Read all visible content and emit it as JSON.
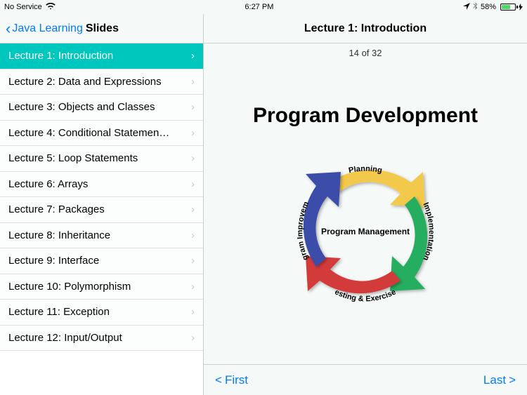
{
  "status": {
    "service": "No Service",
    "time": "6:27 PM",
    "battery_percent": "58%"
  },
  "sidebar": {
    "back_label": "Java Learning",
    "title": "Slides",
    "items": [
      {
        "label": "Lecture 1: Introduction",
        "selected": true
      },
      {
        "label": "Lecture 2: Data and Expressions",
        "selected": false
      },
      {
        "label": "Lecture 3: Objects and Classes",
        "selected": false
      },
      {
        "label": "Lecture 4: Conditional Statemen…",
        "selected": false
      },
      {
        "label": "Lecture 5: Loop Statements",
        "selected": false
      },
      {
        "label": "Lecture 6: Arrays",
        "selected": false
      },
      {
        "label": "Lecture 7: Packages",
        "selected": false
      },
      {
        "label": "Lecture 8: Inheritance",
        "selected": false
      },
      {
        "label": "Lecture 9: Interface",
        "selected": false
      },
      {
        "label": "Lecture 10: Polymorphism",
        "selected": false
      },
      {
        "label": "Lecture 11: Exception",
        "selected": false
      },
      {
        "label": "Lecture 12: Input/Output",
        "selected": false
      }
    ]
  },
  "main": {
    "header_title": "Lecture 1: Introduction",
    "slide_counter": "14 of 32",
    "slide": {
      "title": "Program Development",
      "center_label": "Program Management",
      "phases": {
        "planning": "Planning",
        "implementation": "Implementation",
        "testing": "Testing & Exercises",
        "improvement": "Program Improvement"
      },
      "colors": {
        "planning": "#f2c94c",
        "implementation": "#27ae60",
        "testing": "#d33a3a",
        "improvement": "#3b4ea8"
      }
    }
  },
  "footer": {
    "first": "First",
    "last": "Last"
  }
}
